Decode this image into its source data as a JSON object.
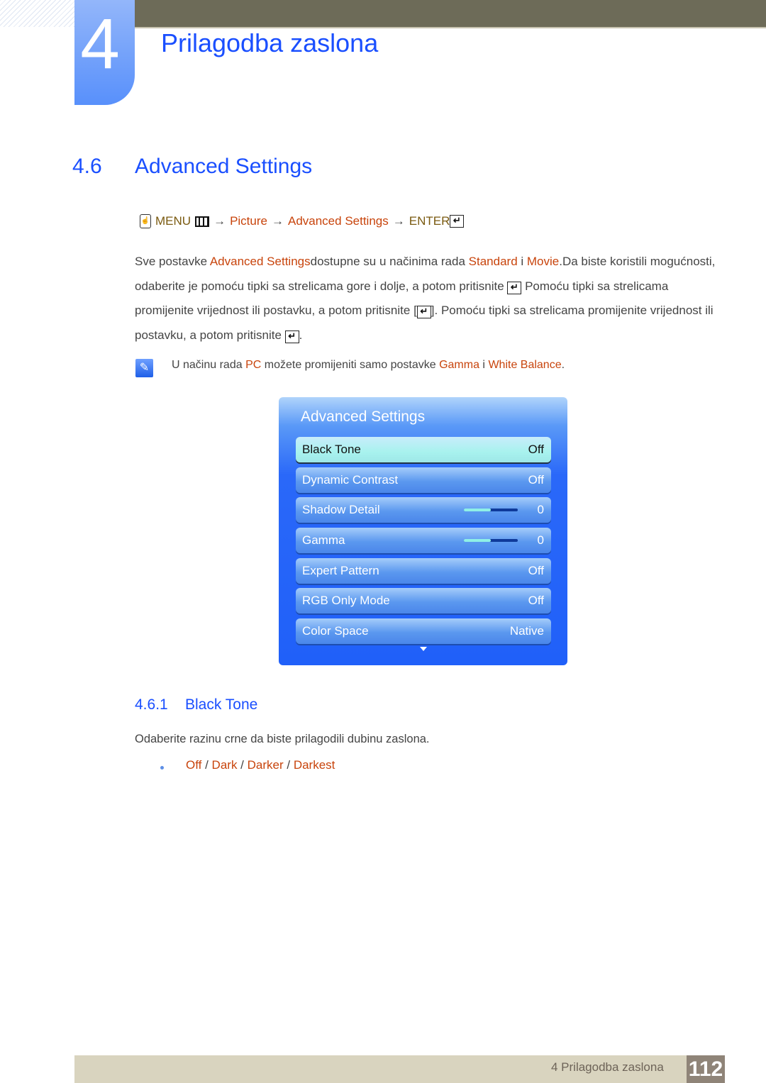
{
  "header": {
    "chapter_number": "4",
    "chapter_title": "Prilagodba zaslona"
  },
  "section": {
    "number": "4.6",
    "title": "Advanced Settings"
  },
  "menu_path": {
    "menu": "MENU",
    "arrow": "→",
    "steps": [
      "Picture",
      "Advanced Settings"
    ],
    "enter": "ENTER"
  },
  "paragraph": {
    "p1": "Sve postavke ",
    "p1_red": "Advanced Settings",
    "p2": "dostupne su u načinima rada ",
    "p2_red1": "Standard",
    "p2_i": " i ",
    "p2_red2": "Movie",
    "p3": ".Da biste koristili mogućnosti, odaberite je pomoću tipki sa strelicama gore i dolje, a potom pritisnite ",
    "p4": " Pomoću tipki sa strelicama promijenite vrijednost ili postavku, a potom pritisnite [",
    "p5": "]. Pomoću tipki sa strelicama promijenite vrijednost ili postavku, a potom pritisnite ",
    "p6": "."
  },
  "note": {
    "t1": "U načinu rada ",
    "pc": "PC",
    "t2": " možete promijeniti samo postavke ",
    "gamma": "Gamma",
    "i": " i ",
    "wb": "White Balance",
    "end": "."
  },
  "osd": {
    "title": "Advanced Settings",
    "items": [
      {
        "label": "Black Tone",
        "value": "Off",
        "selected": true
      },
      {
        "label": "Dynamic Contrast",
        "value": "Off"
      },
      {
        "label": "Shadow Detail",
        "value": "0",
        "slider": 0.5
      },
      {
        "label": "Gamma",
        "value": "0",
        "slider": 0.5
      },
      {
        "label": "Expert Pattern",
        "value": "Off"
      },
      {
        "label": "RGB Only Mode",
        "value": "Off"
      },
      {
        "label": "Color Space",
        "value": "Native"
      }
    ]
  },
  "subsection": {
    "number": "4.6.1",
    "title": "Black Tone",
    "body": "Odaberite razinu crne da biste prilagodili dubinu zaslona.",
    "options": [
      "Off",
      "Dark",
      "Darker",
      "Darkest"
    ],
    "separator": " / "
  },
  "footer": {
    "chapter_label": "4 Prilagodba zaslona",
    "page_number": "112"
  }
}
